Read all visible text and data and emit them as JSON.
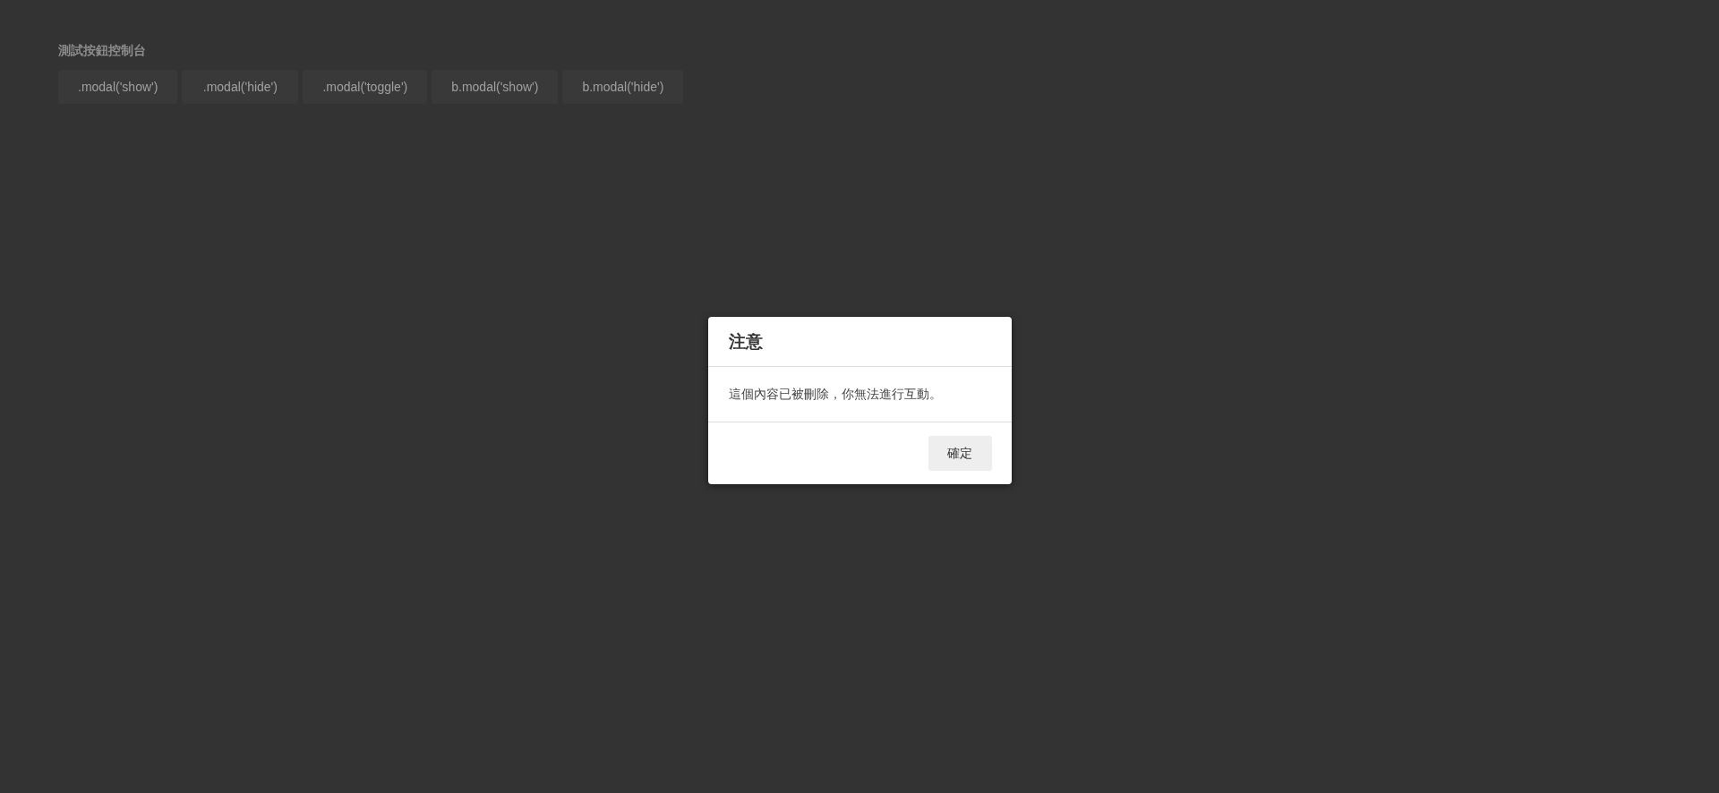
{
  "page": {
    "title": "測試按鈕控制台",
    "buttons": [
      ".modal('show')",
      ".modal('hide')",
      ".modal('toggle')",
      "b.modal('show')",
      "b.modal('hide')"
    ]
  },
  "modal": {
    "title": "注意",
    "message": "這個內容已被刪除，你無法進行互動。",
    "buttons": [
      "確定"
    ]
  }
}
